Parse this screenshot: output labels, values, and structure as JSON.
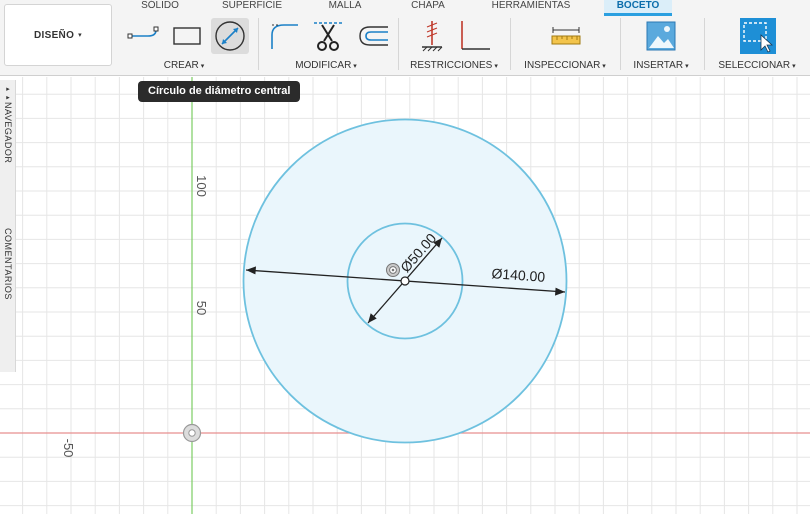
{
  "design_button": {
    "label": "DISEÑO",
    "caret": "▾"
  },
  "tabs": [
    {
      "label": "SÓLIDO"
    },
    {
      "label": "SUPERFICIE"
    },
    {
      "label": "MALLA"
    },
    {
      "label": "CHAPA"
    },
    {
      "label": "HERRAMIENTAS"
    },
    {
      "label": "BOCETO",
      "active": true
    }
  ],
  "groups": {
    "crear": "CREAR",
    "modificar": "MODIFICAR",
    "restricciones": "RESTRICCIONES",
    "inspeccionar": "INSPECCIONAR",
    "insertar": "INSERTAR",
    "seleccionar": "SELECCIONAR",
    "caret": "▾"
  },
  "tooltip": "Círculo de diámetro central",
  "side_panel": {
    "navigator": "NAVEGADOR",
    "comments": "COMENTARIOS",
    "collapse": "▸▸"
  },
  "axis_labels": {
    "y100": "100",
    "y50": "50",
    "x_neg50": "-50"
  },
  "dimensions": {
    "outer": "Ø140.00",
    "inner": "Ø50.00"
  },
  "colors": {
    "sketch_line": "#6ec1df",
    "sketch_fill": "#eaf6fc",
    "grid": "#e6e6e6",
    "axis_green": "#7ccd63",
    "axis_red": "#e88f8f",
    "accent": "#2a9fe0"
  }
}
